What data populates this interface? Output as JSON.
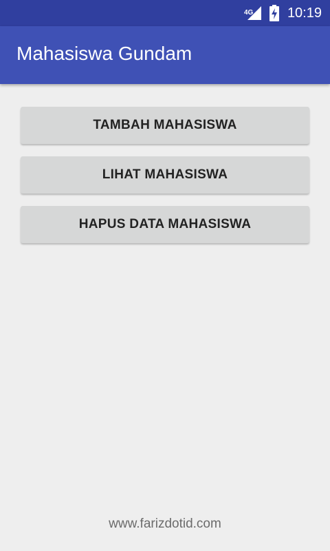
{
  "status_bar": {
    "network_label": "4G",
    "time": "10:19",
    "icons": [
      "signal-icon",
      "battery-charging-icon"
    ]
  },
  "app_bar": {
    "title": "Mahasiswa Gundam"
  },
  "buttons": [
    {
      "label": "TAMBAH MAHASISWA"
    },
    {
      "label": "LIHAT MAHASISWA"
    },
    {
      "label": "HAPUS DATA MAHASISWA"
    }
  ],
  "footer": {
    "text": "www.farizdotid.com"
  },
  "colors": {
    "status_bar": "#303f9f",
    "app_bar": "#3f51b5",
    "background": "#eeeeee",
    "button": "#d6d7d7"
  }
}
